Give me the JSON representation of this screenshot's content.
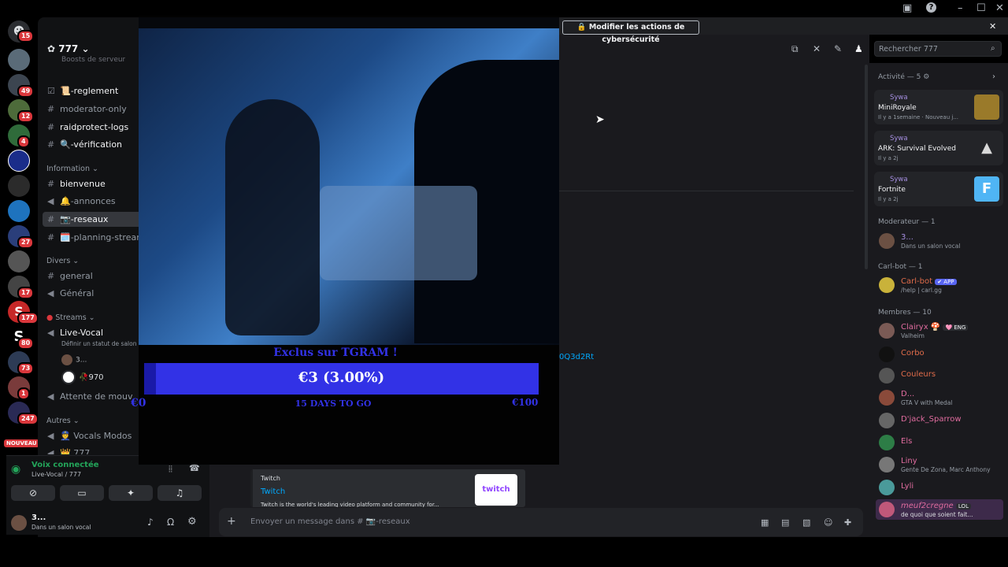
{
  "window": {
    "help": "?",
    "minimize": "–",
    "maximize": "☐",
    "close": "✕"
  },
  "notice": {
    "button_label": "Modifier les actions de cybersécurité",
    "close": "✕"
  },
  "rail": {
    "home_badge": "15",
    "badges": [
      "49",
      "12",
      "4",
      "27",
      "17",
      "177",
      "80",
      "73",
      "1",
      "247"
    ],
    "new_label": "NOUVEAU",
    "letters": [
      "S",
      "S"
    ]
  },
  "server": {
    "name": "777",
    "boost_text": "Boosts de serveur"
  },
  "channels": {
    "reglement": "📜-reglement",
    "moderator_only": "moderator-only",
    "raidprotect_logs": "raidprotect-logs",
    "verification": "🔍-vérification",
    "cat_information": "Information",
    "bienvenue": "bienvenue",
    "annonces": "🔔-annonces",
    "reseaux": "📷-reseaux",
    "planning": "🗓️-planning-streams",
    "cat_divers": "Divers",
    "general": "general",
    "general_voice": "Général",
    "cat_streams": "Streams",
    "live_vocal": "Live-Vocal",
    "live_status": "Définir un statut de salon",
    "vc_user1": "3...",
    "vc_user2": "🥀970",
    "attente": "Attente de mouv",
    "cat_autres": "Autres",
    "vocals_modos": "👮 Vocals Modos",
    "last": "👑 777"
  },
  "voice": {
    "status": "Voix connectée",
    "channel": "Live-Vocal / 777",
    "user": "3...",
    "user_status": "Dans un salon vocal"
  },
  "overlay": {
    "title": "Exclus sur TGRAM !",
    "amount": "€3 (3.00%)",
    "min": "€0",
    "days": "15 DAYS TO GO",
    "max": "€100",
    "progress_fraction": 0.03
  },
  "chat": {
    "link_fragment": "0Q3d2Rt",
    "embed_provider": "Twitch",
    "embed_title": "Twitch",
    "embed_desc": "Twitch is the world's leading video platform and community for...",
    "embed_logo": "twitch",
    "composer_placeholder": "Envoyer un message dans # 📷-reseaux"
  },
  "search": {
    "placeholder": "Rechercher 777"
  },
  "members": {
    "activity_title": "Activité — 5",
    "activities": [
      {
        "user": "Sywa",
        "game": "MiniRoyale",
        "meta": "Il y a 1semaine",
        "extra": "Nouveau j..."
      },
      {
        "user": "Sywa",
        "game": "ARK: Survival Evolved",
        "meta": "Il y a 2j"
      },
      {
        "user": "Sywa",
        "game": "Fortnite",
        "meta": "Il y a 2j"
      }
    ],
    "mod_title": "Moderateur — 1",
    "mod": {
      "name": "3...",
      "sub": "Dans un salon vocal"
    },
    "bot_title": "Carl-bot — 1",
    "bot": {
      "name": "Carl-bot",
      "tag": "✔ APP",
      "sub": "/help | carl.gg"
    },
    "members_title": "Membres — 10",
    "list": [
      {
        "name": "Clairyx",
        "tag": "🩷 ENG",
        "sub": "Valheim",
        "color": "#e06c9f"
      },
      {
        "name": "Corbo",
        "sub": "",
        "color": "#e06c4a"
      },
      {
        "name": "Couleurs",
        "sub": "",
        "color": "#e06c4a"
      },
      {
        "name": "D...",
        "sub": "GTA V with Medal",
        "color": "#e06c9f"
      },
      {
        "name": "D'jack_Sparrow",
        "sub": "",
        "color": "#e06c9f"
      },
      {
        "name": "Els",
        "sub": "",
        "color": "#e06c9f"
      },
      {
        "name": "Liny",
        "sub": "Gente De Zona, Marc Anthony",
        "color": "#e06c9f"
      },
      {
        "name": "Lyli",
        "sub": "",
        "color": "#e06c9f"
      },
      {
        "name": "meuf2cregne",
        "tag": "LOL",
        "sub": "de quoi que soient fait...",
        "color": "#e06c9f"
      },
      {
        "name": "✖✖",
        "sub": "",
        "color": "#e06c9f"
      }
    ]
  }
}
